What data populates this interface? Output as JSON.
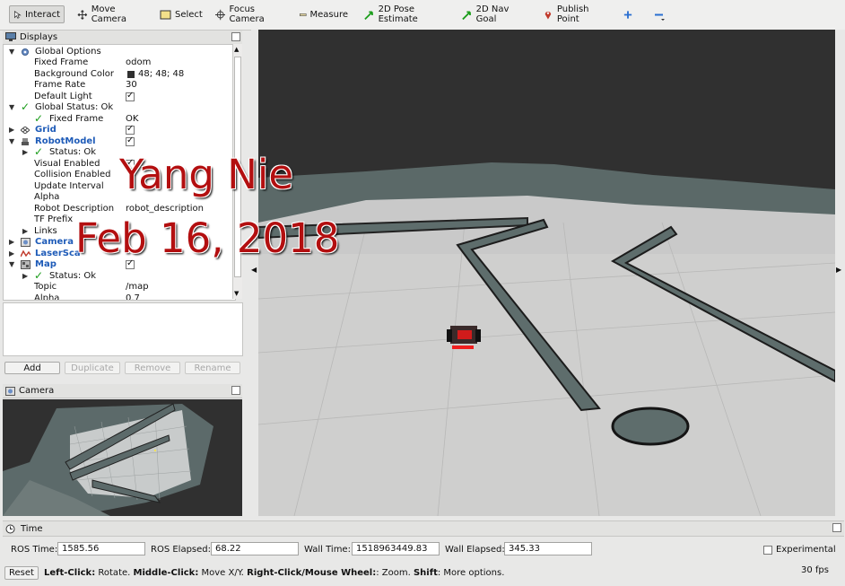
{
  "toolbar": {
    "tools": [
      {
        "label": "Interact",
        "icon": "interact-cursor-icon"
      },
      {
        "label": "Move Camera",
        "icon": "move-camera-icon"
      },
      {
        "label": "Select",
        "icon": "select-box-icon"
      },
      {
        "label": "Focus Camera",
        "icon": "focus-camera-icon"
      },
      {
        "label": "Measure",
        "icon": "measure-ruler-icon"
      },
      {
        "label": "2D Pose Estimate",
        "icon": "green-arrow-icon"
      },
      {
        "label": "2D Nav Goal",
        "icon": "green-arrow-icon"
      },
      {
        "label": "Publish Point",
        "icon": "map-pin-icon"
      }
    ],
    "plus_icon": "plus-icon",
    "minus_icon": "minus-dropdown-icon"
  },
  "displays": {
    "title": "Displays",
    "rows": [
      {
        "label": "Global Options",
        "value": ""
      },
      {
        "label": "Fixed Frame",
        "value": "odom"
      },
      {
        "label": "Background Color",
        "value": "48; 48; 48"
      },
      {
        "label": "Frame Rate",
        "value": "30"
      },
      {
        "label": "Default Light",
        "value": ""
      },
      {
        "label": "Global Status: Ok",
        "value": ""
      },
      {
        "label": "Fixed Frame",
        "value": "OK"
      },
      {
        "label": "Grid",
        "value": ""
      },
      {
        "label": "RobotModel",
        "value": ""
      },
      {
        "label": "Status: Ok",
        "value": ""
      },
      {
        "label": "Visual Enabled",
        "value": ""
      },
      {
        "label": "Collision Enabled",
        "value": ""
      },
      {
        "label": "Update Interval",
        "value": ""
      },
      {
        "label": "Alpha",
        "value": ""
      },
      {
        "label": "Robot Description",
        "value": "robot_description"
      },
      {
        "label": "TF Prefix",
        "value": ""
      },
      {
        "label": "Links",
        "value": ""
      },
      {
        "label": "Camera",
        "value": ""
      },
      {
        "label": "LaserSca",
        "value": ""
      },
      {
        "label": "Map",
        "value": ""
      },
      {
        "label": "Status: Ok",
        "value": ""
      },
      {
        "label": "Topic",
        "value": "/map"
      },
      {
        "label": "Alpha",
        "value": "0.7"
      }
    ],
    "buttons": {
      "add": "Add",
      "duplicate": "Duplicate",
      "remove": "Remove",
      "rename": "Rename"
    }
  },
  "camera_panel": {
    "title": "Camera"
  },
  "overlay": {
    "line1": "Yang Nie",
    "line2": "Feb 16, 2018"
  },
  "time": {
    "title": "Time",
    "ros_time_label": "ROS Time:",
    "ros_time": "1585.56",
    "ros_elapsed_label": "ROS Elapsed:",
    "ros_elapsed": "68.22",
    "wall_time_label": "Wall Time:",
    "wall_time": "1518963449.83",
    "wall_elapsed_label": "Wall Elapsed:",
    "wall_elapsed": "345.33",
    "experimental_label": "Experimental"
  },
  "status": {
    "reset": "Reset",
    "left_click": "Left-Click:",
    "left_click_action": " Rotate. ",
    "middle_click": "Middle-Click:",
    "middle_click_action": " Move X/Y. ",
    "right_click": "Right-Click/Mouse Wheel:",
    "right_click_action": ": Zoom. ",
    "shift": "Shift",
    "shift_action": ": More options.",
    "fps": "30 fps"
  },
  "colors": {
    "background": "#303030",
    "accent_blue": "#1e5bb8",
    "overlay_red": "#b30f10"
  }
}
